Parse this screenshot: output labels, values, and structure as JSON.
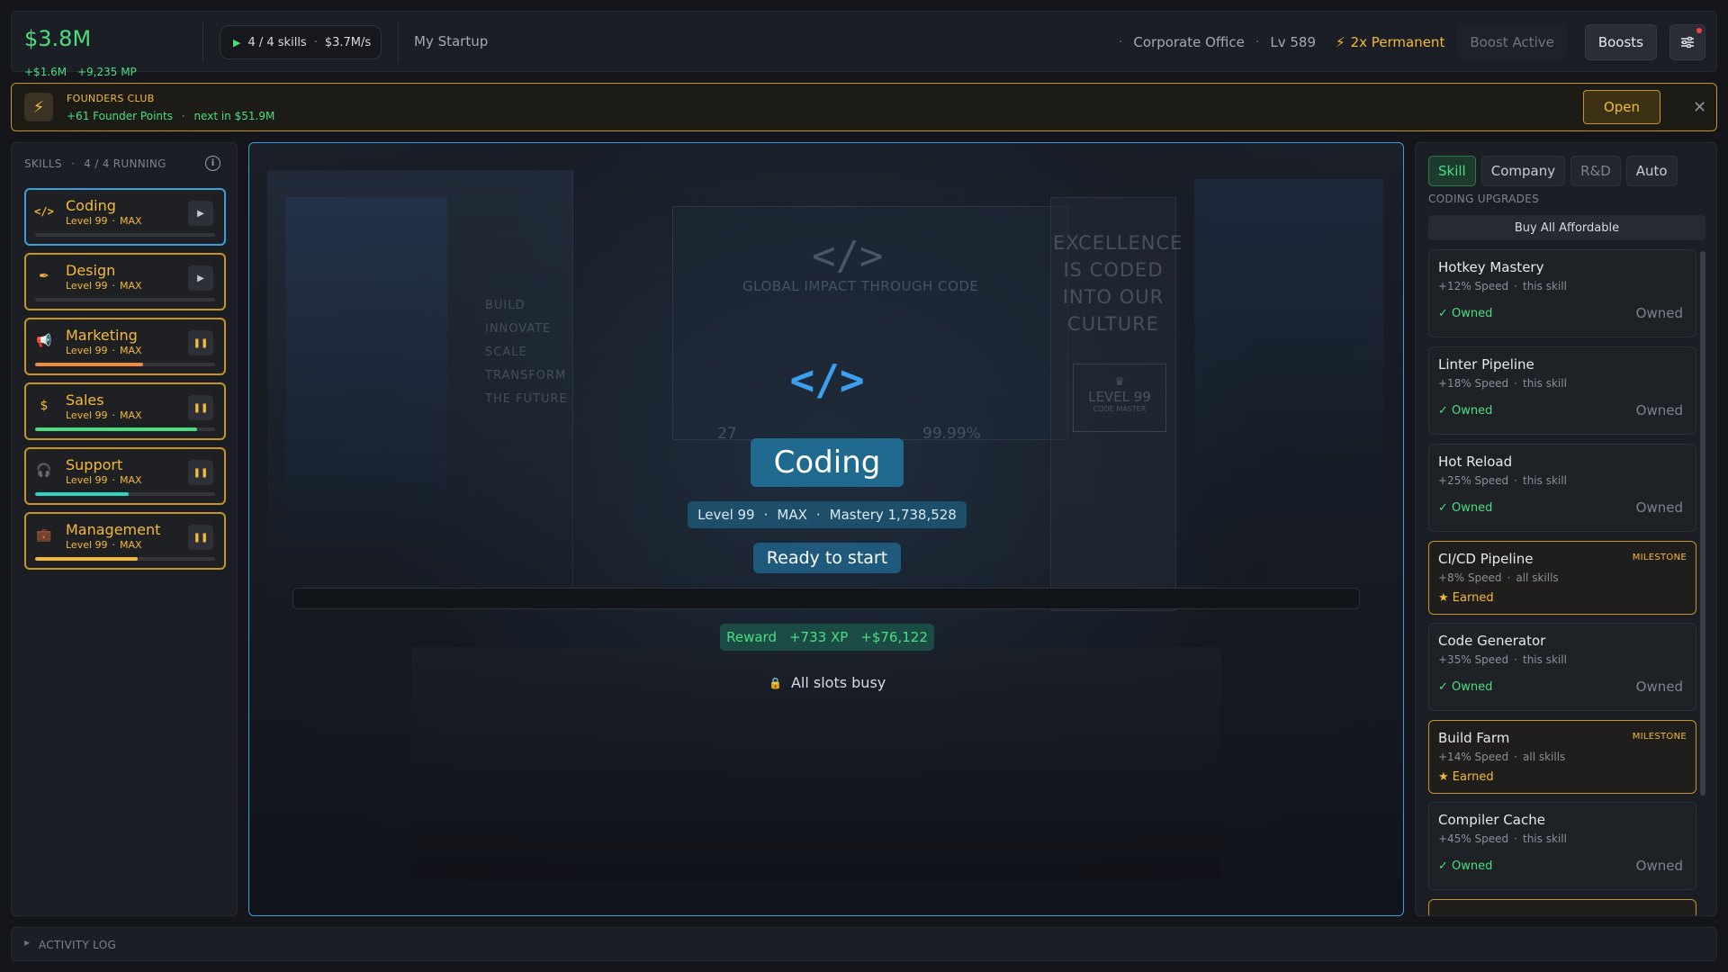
{
  "header": {
    "money": "$3.8M",
    "money_gain": "+$1.6M",
    "mp_gain": "+9,235 MP",
    "running_label": "4 / 4 skills",
    "rate": "$3.7M/s",
    "company_name": "My Startup",
    "location": "Corporate Office",
    "level": "Lv 589",
    "boost_permanent": "2x Permanent",
    "boost_active": "Boost Active",
    "boosts_button": "Boosts"
  },
  "founders": {
    "title": "FOUNDERS CLUB",
    "points": "+61 Founder Points",
    "next": "next in $51.9M",
    "open_button": "Open"
  },
  "sidebar": {
    "heading": "SKILLS",
    "running": "4 / 4 RUNNING",
    "skills": [
      {
        "name": "Coding",
        "level": "Level 99",
        "max": "MAX",
        "state": "play",
        "progress": 0.0,
        "color": "#3b9ddb"
      },
      {
        "name": "Design",
        "level": "Level 99",
        "max": "MAX",
        "state": "play",
        "progress": 0.0,
        "color": "#c9951f"
      },
      {
        "name": "Marketing",
        "level": "Level 99",
        "max": "MAX",
        "state": "pause",
        "progress": 0.6,
        "color": "#f08a3c"
      },
      {
        "name": "Sales",
        "level": "Level 99",
        "max": "MAX",
        "state": "pause",
        "progress": 0.9,
        "color": "#4ade80"
      },
      {
        "name": "Support",
        "level": "Level 99",
        "max": "MAX",
        "state": "pause",
        "progress": 0.52,
        "color": "#2dd4bf"
      },
      {
        "name": "Management",
        "level": "Level 99",
        "max": "MAX",
        "state": "pause",
        "progress": 0.57,
        "color": "#f5b93a"
      }
    ]
  },
  "stage": {
    "title": "Coding",
    "level": "Level 99",
    "max": "MAX",
    "mastery": "Mastery 1,738,528",
    "status": "Ready to start",
    "reward_label": "Reward",
    "reward_xp": "+733 XP",
    "reward_money": "+$76,122",
    "slots": "All slots busy",
    "progress": 0.0,
    "backdrop": {
      "board_line": "GLOBAL IMPACT THROUGH CODE",
      "left_words": [
        "BUILD",
        "INNOVATE",
        "SCALE",
        "TRANSFORM",
        "THE FUTURE"
      ],
      "right_words": [
        "EXCELLENCE",
        "IS CODED",
        "INTO OUR",
        "CULTURE"
      ],
      "plaque_level": "LEVEL 99",
      "plaque_sub": "CODE MASTER",
      "stat1": "27",
      "stat2": "99.99%"
    }
  },
  "upgrades": {
    "tabs": [
      "Skill",
      "Company",
      "R&D",
      "Auto"
    ],
    "heading": "CODING UPGRADES",
    "buy_all": "Buy All Affordable",
    "cards": [
      {
        "name": "Hotkey Mastery",
        "bonus": "+12% Speed",
        "scope": "this skill",
        "status": "✓ Owned",
        "right": "Owned",
        "milestone": false
      },
      {
        "name": "Linter Pipeline",
        "bonus": "+18% Speed",
        "scope": "this skill",
        "status": "✓ Owned",
        "right": "Owned",
        "milestone": false
      },
      {
        "name": "Hot Reload",
        "bonus": "+25% Speed",
        "scope": "this skill",
        "status": "✓ Owned",
        "right": "Owned",
        "milestone": false
      },
      {
        "name": "CI/CD Pipeline",
        "bonus": "+8% Speed",
        "scope": "all skills",
        "status": "★ Earned",
        "right": "",
        "milestone": true,
        "tag": "MILESTONE"
      },
      {
        "name": "Code Generator",
        "bonus": "+35% Speed",
        "scope": "this skill",
        "status": "✓ Owned",
        "right": "Owned",
        "milestone": false
      },
      {
        "name": "Build Farm",
        "bonus": "+14% Speed",
        "scope": "all skills",
        "status": "★ Earned",
        "right": "",
        "milestone": true,
        "tag": "MILESTONE"
      },
      {
        "name": "Compiler Cache",
        "bonus": "+45% Speed",
        "scope": "this skill",
        "status": "✓ Owned",
        "right": "Owned",
        "milestone": false
      }
    ]
  },
  "activity_log": {
    "label": "ACTIVITY LOG"
  }
}
